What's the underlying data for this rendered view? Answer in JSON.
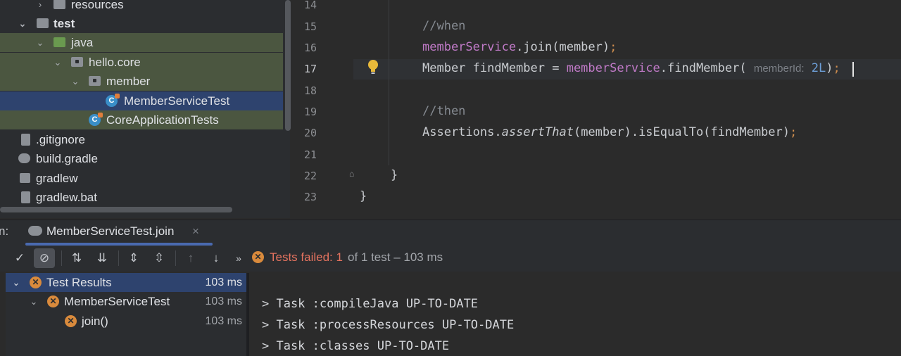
{
  "project_tree": {
    "items": [
      {
        "label": "resources"
      },
      {
        "label": "test"
      },
      {
        "label": "java"
      },
      {
        "label": "hello.core"
      },
      {
        "label": "member"
      },
      {
        "label": "MemberServiceTest"
      },
      {
        "label": "CoreApplicationTests"
      },
      {
        "label": ".gitignore"
      },
      {
        "label": "build.gradle"
      },
      {
        "label": "gradlew"
      },
      {
        "label": "gradlew.bat"
      }
    ]
  },
  "editor": {
    "line_numbers": [
      "14",
      "15",
      "16",
      "17",
      "18",
      "19",
      "20",
      "21",
      "22",
      "23"
    ],
    "current_line": "17",
    "lines": {
      "l15": "//when",
      "l16a": "memberService",
      "l16b": ".join(member)",
      "l16c": ";",
      "l17a": "Member findMember = ",
      "l17b": "memberService",
      "l17c": ".findMember(",
      "l17hint": "memberId:",
      "l17d": "2L",
      "l17e": ")",
      "l17f": ";",
      "l19": "//then",
      "l20a": "Assertions.",
      "l20b": "assertThat",
      "l20c": "(member).isEqualTo(findMember)",
      "l20d": ";",
      "l22": "}",
      "l23": "}"
    }
  },
  "run_panel": {
    "label_prefix": "n:",
    "tab_label": "MemberServiceTest.join",
    "tab_close": "×",
    "status_failed": "Tests failed: 1",
    "status_rest": " of 1 test – 103 ms",
    "results": [
      {
        "label": "Test Results",
        "time": "103 ms"
      },
      {
        "label": "MemberServiceTest",
        "time": "103 ms"
      },
      {
        "label": "join()",
        "time": "103 ms"
      }
    ],
    "console": [
      "> Task :compileJava UP-TO-DATE",
      "> Task :processResources UP-TO-DATE",
      "> Task :classes UP-TO-DATE"
    ]
  },
  "colors": {
    "failed": "#e5735f",
    "selection": "#2e436e",
    "test_folder_bg": "#4b5640"
  }
}
